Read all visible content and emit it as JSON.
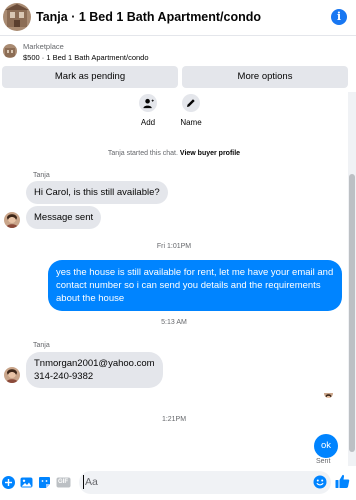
{
  "header": {
    "title": "Tanja · 1 Bed 1 Bath Apartment/condo",
    "info_icon": "info-icon"
  },
  "listing": {
    "source": "Marketplace",
    "price_title": "$500 · 1 Bed 1 Bath Apartment/condo",
    "pending_button": "Mark as pending",
    "more_button": "More options"
  },
  "actions": [
    {
      "label": "Add",
      "icon": "add-person-icon"
    },
    {
      "label": "Name",
      "icon": "pencil-icon"
    }
  ],
  "system_message": {
    "text": "Tanja started this chat.",
    "link": "View buyer profile"
  },
  "messages": [
    {
      "sender": "Tanja",
      "text": "Hi Carol, is this still available?"
    },
    {
      "text": "Message sent"
    },
    {
      "timestamp": "Fri 1:01PM"
    },
    {
      "text": "yes the house is still available for rent, let me have your email  and contact number so i can send you details and the requirements about the house"
    },
    {
      "timestamp": "5:13 AM"
    },
    {
      "sender": "Tanja",
      "text_line1": "Tnmorgan2001@yahoo.com",
      "text_line2": "314-240-9382"
    },
    {
      "timestamp": "1:21PM"
    },
    {
      "text": "ok",
      "status": "Sent"
    }
  ],
  "composer": {
    "placeholder": "Aa",
    "icons": [
      "plus-icon",
      "image-icon",
      "sticker-icon",
      "gif-icon",
      "emoji-icon",
      "thumbs-up-icon"
    ],
    "gif_label": "GIF"
  },
  "colors": {
    "accent": "#0084ff",
    "brand": "#1877f2",
    "bubble_in": "#e4e6eb"
  }
}
